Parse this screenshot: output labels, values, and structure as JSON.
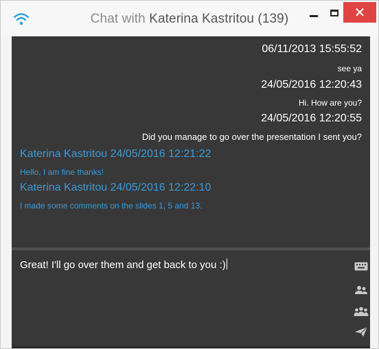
{
  "window": {
    "title_prefix": "Chat with ",
    "title_name": "Katerina Kastritou (139)",
    "colors": {
      "close_button": "#e04343",
      "panel_bg": "#383838",
      "incoming_text": "#3c9ad6",
      "outgoing_text": "#ffffff",
      "wifi_icon": "#2ea1e0"
    },
    "icons": {
      "status": "wifi-icon",
      "minimize": "minimize-icon",
      "maximize": "maximize-icon",
      "close": "close-icon"
    },
    "close_glyph": "✕"
  },
  "messages": [
    {
      "direction": "out",
      "timestamp": "06/11/2013 15:55:52",
      "text": "see ya"
    },
    {
      "direction": "out",
      "timestamp": "24/05/2016 12:20:43",
      "text": "Hi. How are you?"
    },
    {
      "direction": "out",
      "timestamp": "24/05/2016 12:20:55",
      "text": "Did you manage to go over the presentation I sent you?"
    },
    {
      "direction": "in",
      "header": "Katerina Kastritou 24/05/2016 12:21:22",
      "text": "Hello, I am fine thanks!"
    },
    {
      "direction": "in",
      "header": "Katerina Kastritou 24/05/2016 12:22:10",
      "text": "I made some comments on the slides 1, 5 and 13."
    }
  ],
  "composer": {
    "text": "Great! I'll go over them and get back to you :)",
    "tools": [
      "keyboard-icon",
      "contacts-icon",
      "group-icon",
      "send-icon"
    ]
  }
}
